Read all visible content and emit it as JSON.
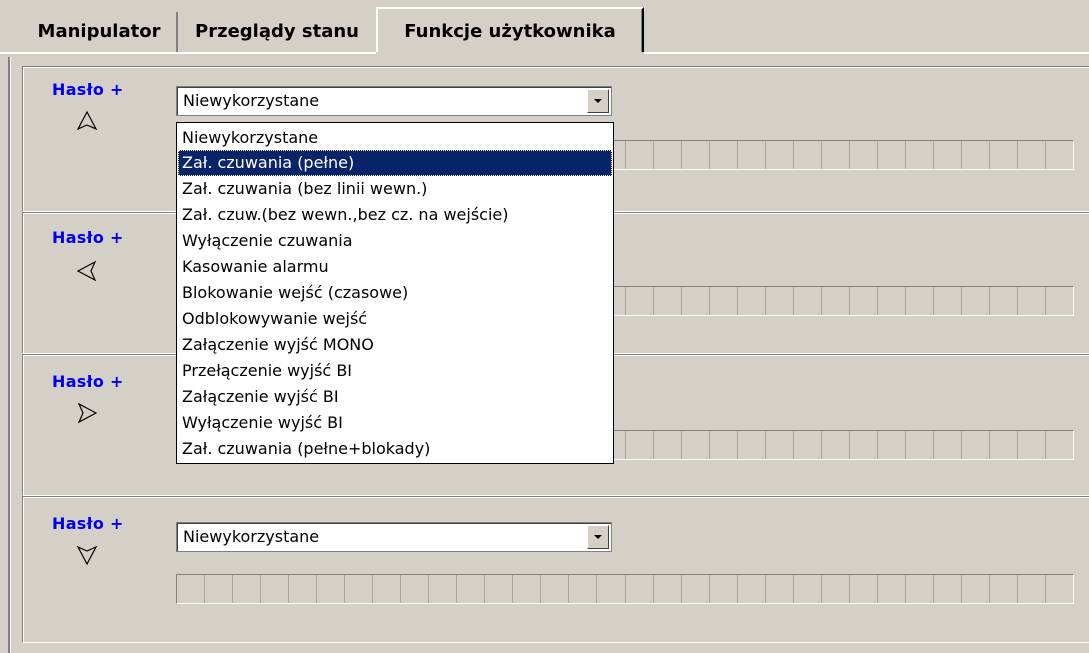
{
  "tabs": [
    {
      "label": "Manipulator"
    },
    {
      "label": "Przeglądy stanu"
    },
    {
      "label": "Funkcje użytkownika",
      "active": true
    }
  ],
  "groups": [
    {
      "haslo_label": "Hasło +",
      "arrow_icon": "arrow-up-icon",
      "selected": "Niewykorzystane"
    },
    {
      "haslo_label": "Hasło +",
      "arrow_icon": "arrow-left-icon"
    },
    {
      "haslo_label": "Hasło +",
      "arrow_icon": "arrow-right-icon"
    },
    {
      "haslo_label": "Hasło +",
      "arrow_icon": "arrow-down-icon",
      "selected": "Niewykorzystane"
    }
  ],
  "dropdown": {
    "highlighted_index": 1,
    "options": [
      "Niewykorzystane",
      "Zał. czuwania (pełne)",
      "Zał. czuwania (bez linii wewn.)",
      "Zał. czuw.(bez wewn.,bez cz. na wejście)",
      "Wyłączenie czuwania",
      "Kasowanie alarmu",
      "Blokowanie wejść (czasowe)",
      "Odblokowywanie wejść",
      "Załączenie wyjść MONO",
      "Przełączenie wyjść BI",
      "Załączenie wyjść BI",
      "Wyłączenie wyjść BI",
      "Zał. czuwania (pełne+blokady)"
    ]
  },
  "colors": {
    "haslo_text": "#0000ee",
    "selection_bg": "#0a246a",
    "window_bg": "#d4d0c8"
  }
}
